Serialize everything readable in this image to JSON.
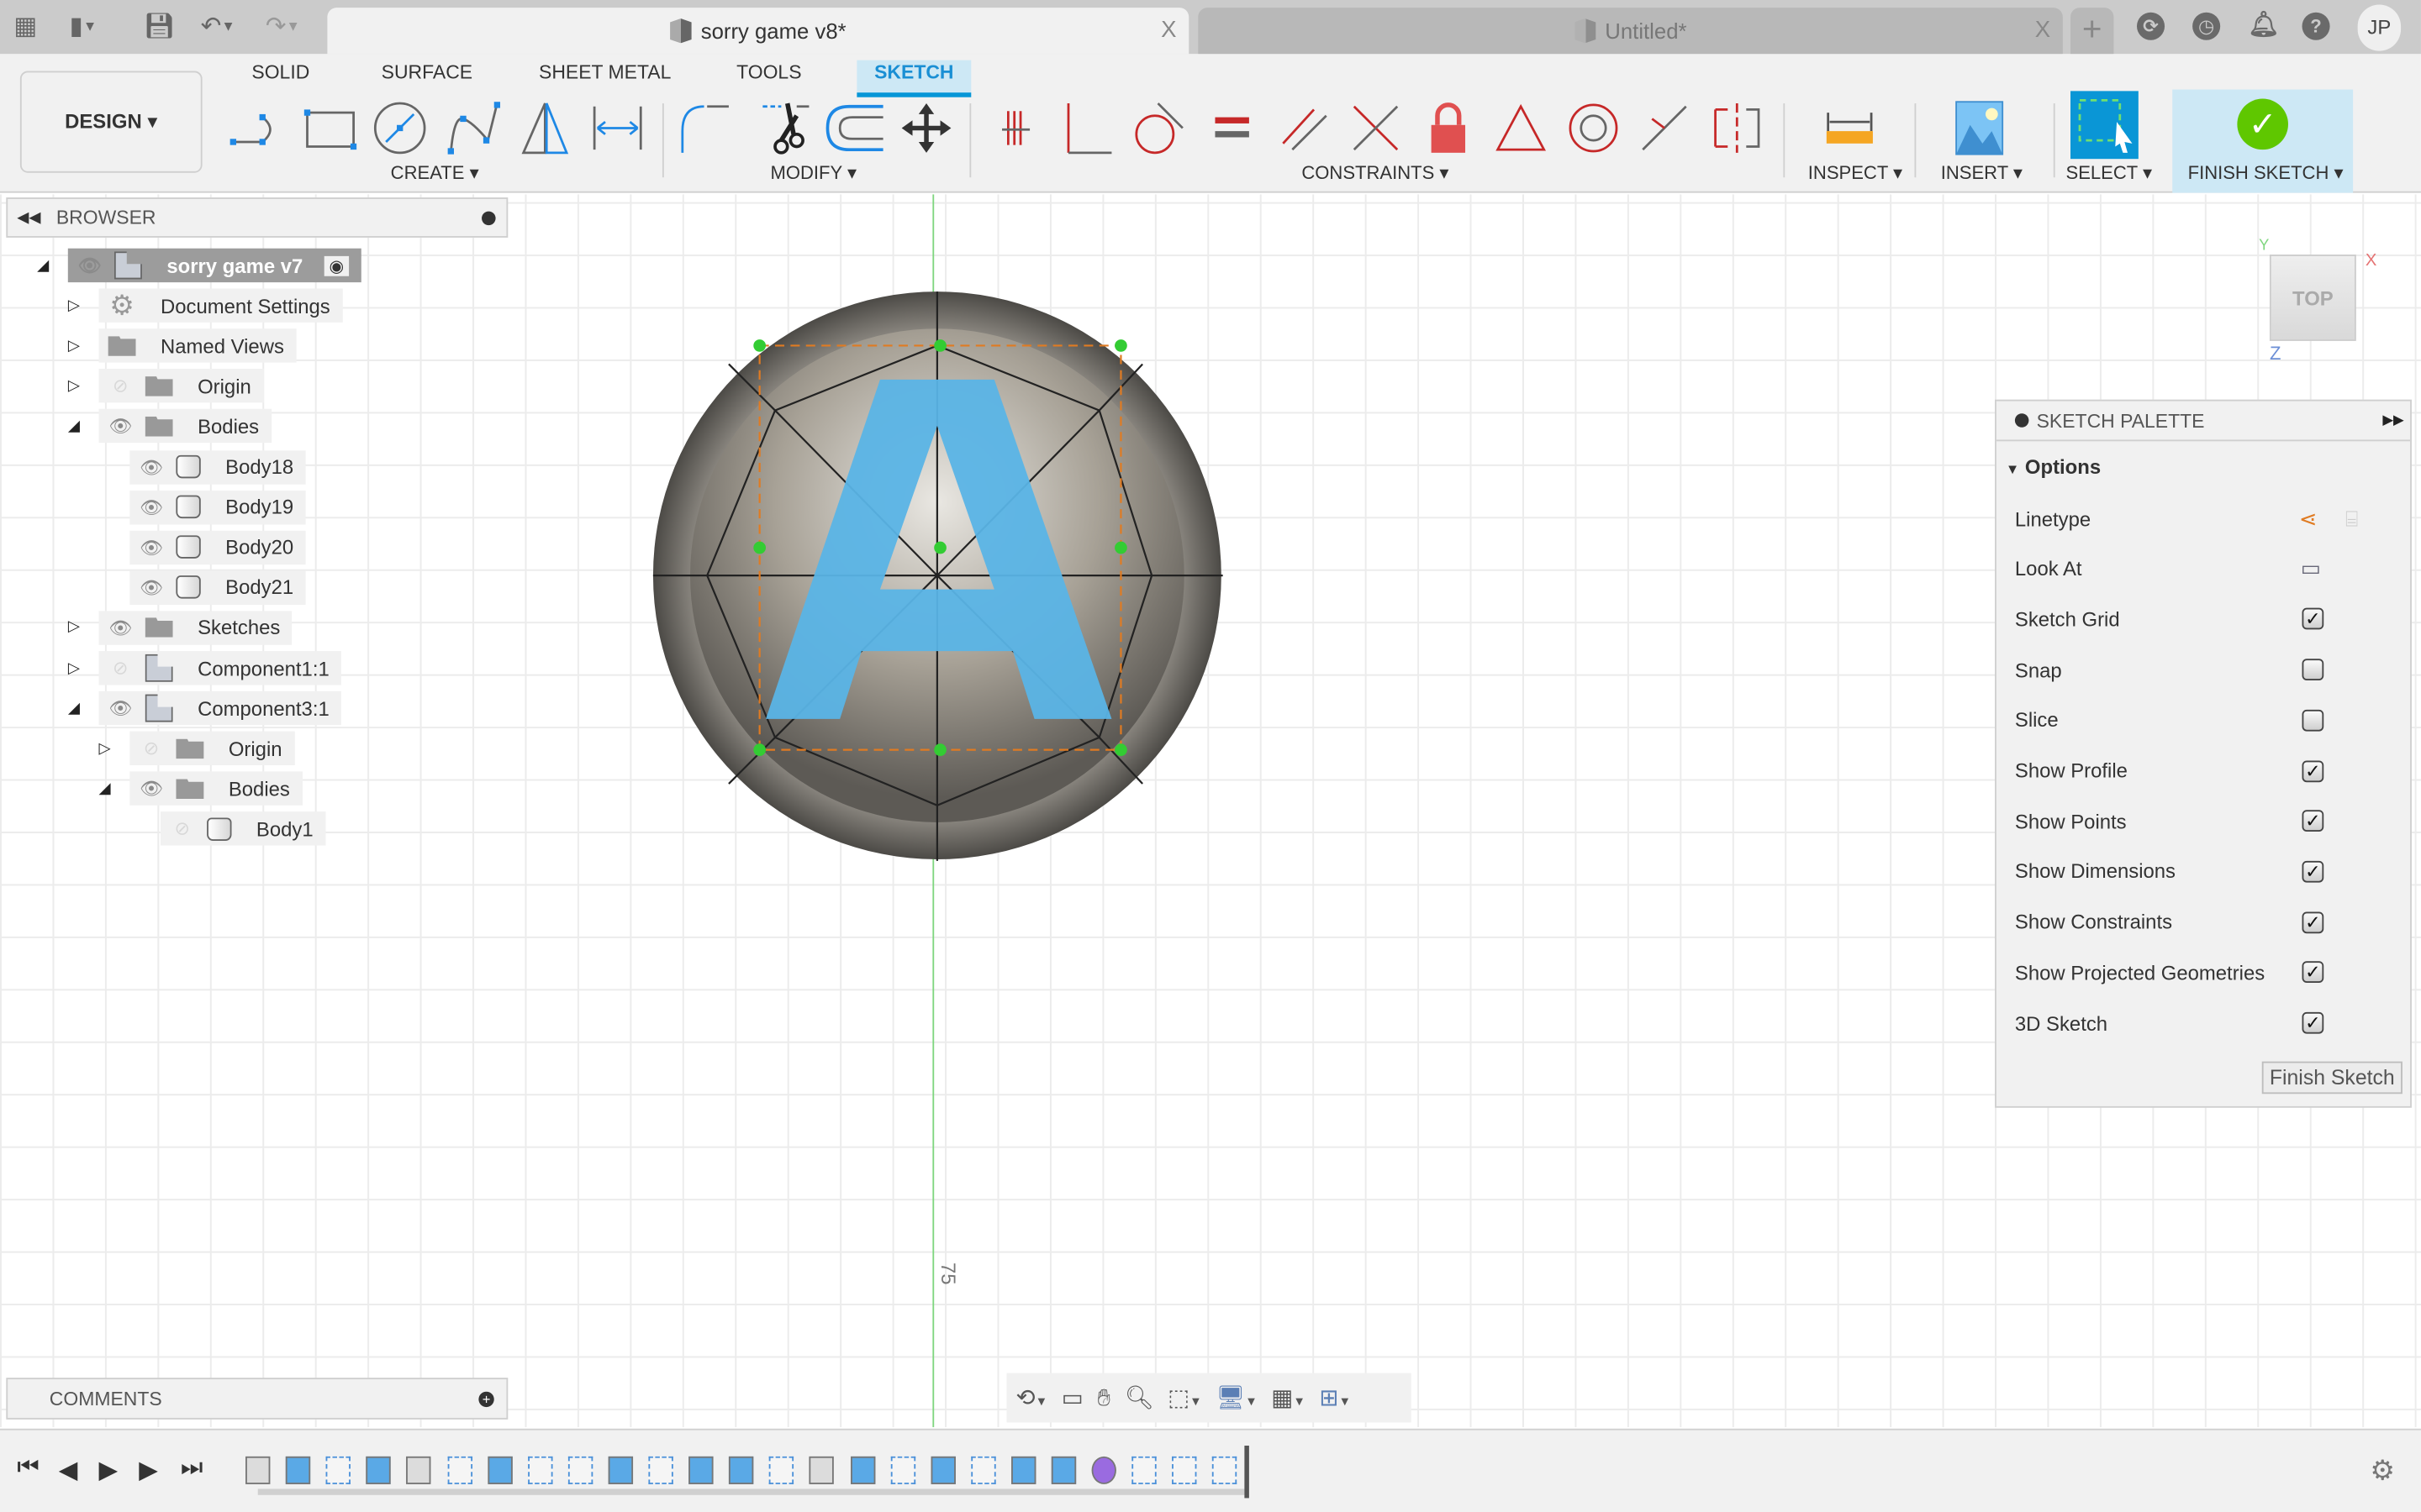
{
  "app": {
    "tabs": [
      {
        "label": "sorry game v8*",
        "active": true
      },
      {
        "label": "Untitled*",
        "active": false
      }
    ],
    "user_initials": "JP",
    "close_glyph": "X",
    "new_tab_glyph": "+"
  },
  "ribbon": {
    "workspace": "DESIGN ▾",
    "tabs": [
      "SOLID",
      "SURFACE",
      "SHEET METAL",
      "TOOLS",
      "SKETCH"
    ],
    "active_tab": "SKETCH",
    "groups": {
      "create": "CREATE ▾",
      "modify": "MODIFY ▾",
      "constraints": "CONSTRAINTS ▾",
      "inspect": "INSPECT ▾",
      "insert": "INSERT ▾",
      "select": "SELECT ▾",
      "finish_sketch": "FINISH SKETCH ▾"
    }
  },
  "browser": {
    "title": "BROWSER",
    "items": [
      {
        "label": "sorry game v7",
        "level": 0,
        "expanded": true,
        "visible": true,
        "icon": "component"
      },
      {
        "label": "Document Settings",
        "level": 1,
        "expanded": false,
        "icon": "gear"
      },
      {
        "label": "Named Views",
        "level": 1,
        "expanded": false,
        "icon": "folder"
      },
      {
        "label": "Origin",
        "level": 1,
        "expanded": false,
        "visible": false,
        "icon": "folder"
      },
      {
        "label": "Bodies",
        "level": 1,
        "expanded": true,
        "visible": true,
        "icon": "folder"
      },
      {
        "label": "Body18",
        "level": 2,
        "visible": true,
        "icon": "body"
      },
      {
        "label": "Body19",
        "level": 2,
        "visible": true,
        "icon": "body"
      },
      {
        "label": "Body20",
        "level": 2,
        "visible": true,
        "icon": "body"
      },
      {
        "label": "Body21",
        "level": 2,
        "visible": true,
        "icon": "body"
      },
      {
        "label": "Sketches",
        "level": 1,
        "expanded": false,
        "visible": true,
        "icon": "folder"
      },
      {
        "label": "Component1:1",
        "level": 1,
        "expanded": false,
        "visible": false,
        "icon": "component"
      },
      {
        "label": "Component3:1",
        "level": 1,
        "expanded": true,
        "visible": true,
        "icon": "component"
      },
      {
        "label": "Origin",
        "level": 2,
        "expanded": false,
        "visible": false,
        "icon": "folder"
      },
      {
        "label": "Bodies",
        "level": 2,
        "expanded": true,
        "visible": true,
        "icon": "folder"
      },
      {
        "label": "Body1",
        "level": 3,
        "visible": false,
        "icon": "body"
      }
    ]
  },
  "comments": {
    "title": "COMMENTS"
  },
  "sketch_palette": {
    "title": "SKETCH PALETTE",
    "section": "Options",
    "rows": [
      {
        "label": "Linetype",
        "type": "icons"
      },
      {
        "label": "Look At",
        "type": "icon"
      },
      {
        "label": "Sketch Grid",
        "type": "checkbox",
        "checked": true
      },
      {
        "label": "Snap",
        "type": "checkbox",
        "checked": false
      },
      {
        "label": "Slice",
        "type": "checkbox",
        "checked": false
      },
      {
        "label": "Show Profile",
        "type": "checkbox",
        "checked": true
      },
      {
        "label": "Show Points",
        "type": "checkbox",
        "checked": true
      },
      {
        "label": "Show Dimensions",
        "type": "checkbox",
        "checked": true
      },
      {
        "label": "Show Constraints",
        "type": "checkbox",
        "checked": true
      },
      {
        "label": "Show Projected Geometries",
        "type": "checkbox",
        "checked": true
      },
      {
        "label": "3D Sketch",
        "type": "checkbox",
        "checked": true
      }
    ],
    "finish_button": "Finish Sketch"
  },
  "viewport": {
    "dimension_label": "75",
    "sketch_letter": "A",
    "viewcube_face": "TOP",
    "axis_labels": {
      "x": "X",
      "y": "Y",
      "z": "Z"
    },
    "colors": {
      "letter": "#5ab4e6",
      "axis_y": "#7fd67f",
      "sketch_point": "#33cc33",
      "construction": "#e07b22"
    }
  },
  "timeline": {
    "items": [
      "body",
      "extrude",
      "sketch",
      "extrude",
      "body",
      "sketch",
      "extrude",
      "sketch",
      "sketch",
      "extrude",
      "sketch",
      "extrude",
      "extrude",
      "sketch",
      "body",
      "extrude",
      "sketch",
      "extrude",
      "sketch",
      "extrude",
      "extrude",
      "form",
      "sketch",
      "joint",
      "sketch"
    ]
  }
}
